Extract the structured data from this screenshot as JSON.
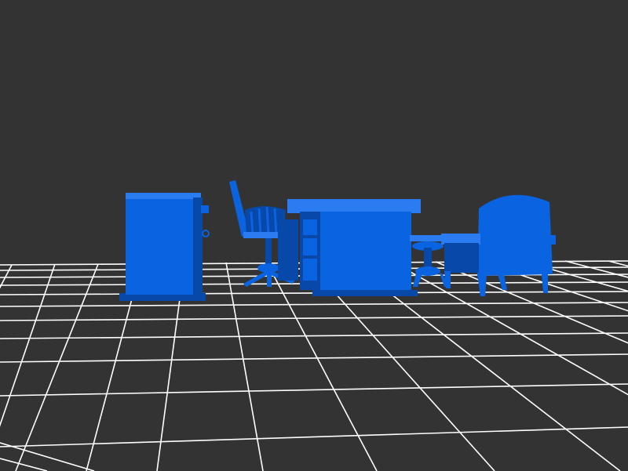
{
  "scene": {
    "background_color": "#333333",
    "grid_color": "#ffffff",
    "object_color": "#0a63e0",
    "object_shadow": "#0848a8",
    "object_highlight": "#2a7cf0",
    "objects": [
      "cabinet",
      "swivel-chair",
      "desk",
      "stool",
      "armchair"
    ]
  }
}
